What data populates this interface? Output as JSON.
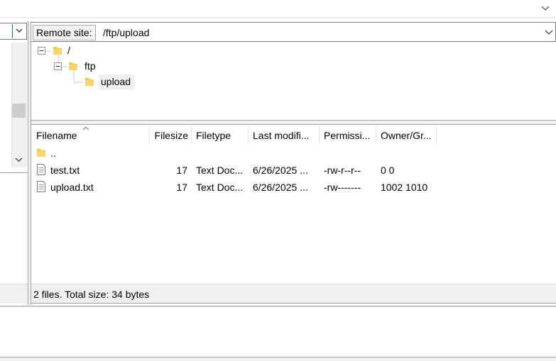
{
  "remote": {
    "label": "Remote site:",
    "path": "/ftp/upload"
  },
  "tree": {
    "items": [
      {
        "label": "/"
      },
      {
        "label": "ftp"
      },
      {
        "label": "upload"
      }
    ]
  },
  "file_list": {
    "columns": [
      "Filename",
      "Filesize",
      "Filetype",
      "Last modifi...",
      "Permissi...",
      "Owner/Gr..."
    ],
    "rows": [
      {
        "name": "..",
        "size": "",
        "type": "",
        "modified": "",
        "perms": "",
        "owner": ""
      },
      {
        "name": "test.txt",
        "size": "17",
        "type": "Text Doc...",
        "modified": "6/26/2025 ...",
        "perms": "-rw-r--r--",
        "owner": "0 0"
      },
      {
        "name": "upload.txt",
        "size": "17",
        "type": "Text Doc...",
        "modified": "6/26/2025 ...",
        "perms": "-rw-------",
        "owner": "1002 1010"
      }
    ]
  },
  "status": {
    "text": "2 files. Total size: 34 bytes"
  },
  "icons": {
    "folder": "folder-icon",
    "file": "text-file-icon",
    "expand": "tree-collapse-icon",
    "combo": "chevron-down-icon",
    "sort": "sort-ascending-icon"
  },
  "colors": {
    "folder": "#f5c542",
    "selection": "#efefef",
    "focus": "#0078d7"
  }
}
